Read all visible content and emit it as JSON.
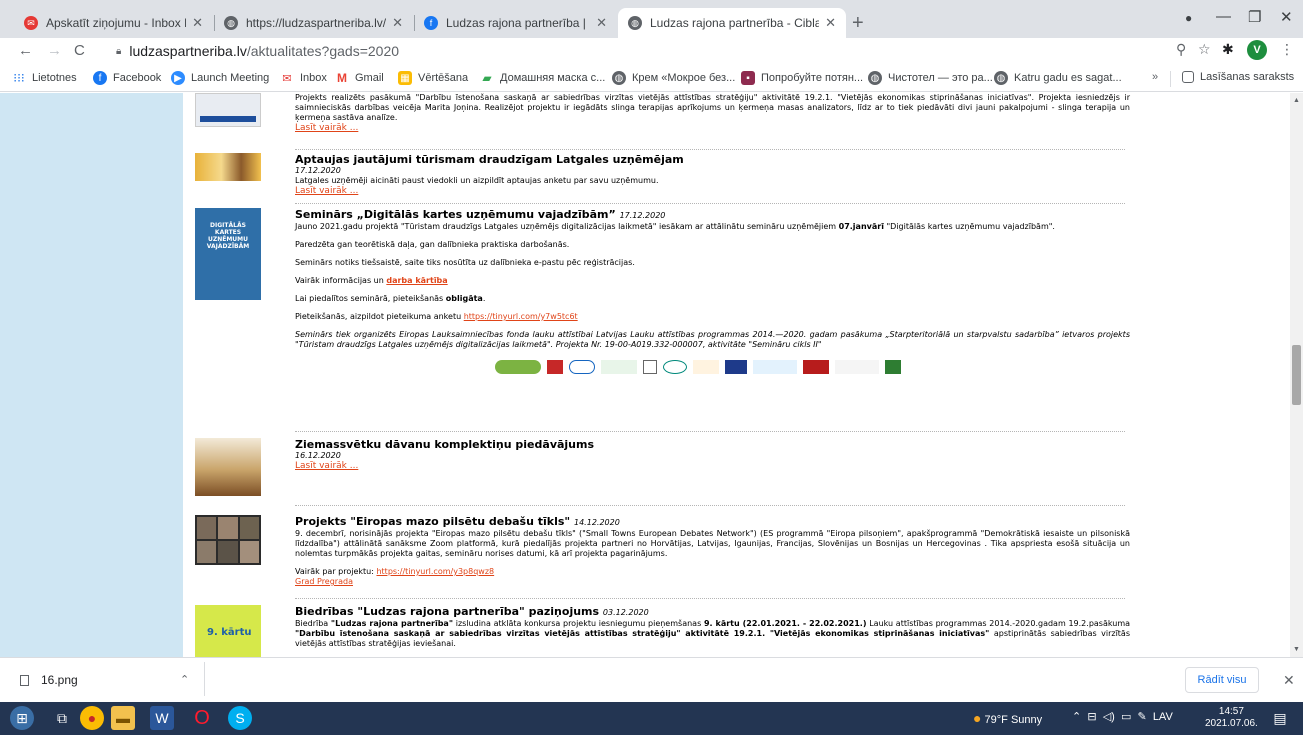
{
  "tabs": [
    {
      "title": "Apskatīt ziņojumu - Inbox Mail"
    },
    {
      "title": "https://ludzaspartneriba.lv/proje"
    },
    {
      "title": "Ludzas rajona partnerība | Facebo"
    },
    {
      "title": "Ludzas rajona partnerība - Ciblas"
    }
  ],
  "address": {
    "domain": "ludzaspartneriba.lv",
    "path": "/aktualitates?gads=2020"
  },
  "profile_initial": "V",
  "bookmarks": [
    {
      "label": "Lietotnes"
    },
    {
      "label": "Facebook"
    },
    {
      "label": "Launch Meeting"
    },
    {
      "label": "Inbox"
    },
    {
      "label": "Gmail"
    },
    {
      "label": "Vērtēšana"
    },
    {
      "label": "Домашняя маска с..."
    },
    {
      "label": "Крем «Мокрое без..."
    },
    {
      "label": "Попробуйте потян..."
    },
    {
      "label": "Чистотел — это ра..."
    },
    {
      "label": "Katru gadu es sagat..."
    }
  ],
  "reading_list": "Lasīšanas saraksts",
  "news": [
    {
      "text": "Projekts realizēts pasākumā \"Darbību īstenošana saskaņā ar sabiedrības virzītas vietējās attīstības stratēģiju\" aktivitātē 19.2.1. \"Vietējās ekonomikas stiprināšanas iniciatīvas\". Projekta iesniedzējs ir saimnieciskās darbības veicēja Marita Joņina. Realizējot projektu ir iegādāts slinga terapijas aprīkojums un ķermeņa masas analizators, līdz ar to tiek piedāvāti divi jauni pakalpojumi - slinga terapija un ķermeņa sastāva analīze.",
      "more": "Lasīt vairāk ..."
    },
    {
      "title": "Aptaujas jautājumi tūrismam draudzīgam Latgales uzņēmējam",
      "date": "17.12.2020",
      "text": "Latgales uzņēmēji aicināti paust viedokli un aizpildīt aptaujas anketu par savu uzņēmumu.",
      "more": "Lasīt vairāk ..."
    },
    {
      "title": "Seminārs „Digitālās kartes uzņēmumu vajadzībām”",
      "date": "17.12.2020",
      "intro_a": "Jauno 2021.gadu projektā \"Tūristam draudzīgs Latgales uzņēmējs digitalizācijas laikmetā\" iesākam ar attālinātu semināru uzņēmējiem",
      "intro_b": "07.janvārī",
      "intro_c": "\"Digitālās kartes uzņēmumu vajadzībām\".",
      "p1": "Paredzēta gan teorētiskā daļa, gan dalībnieka praktiska darbošanās.",
      "p2": "Seminārs notiks tiešsaistē, saite tiks nosūtīta uz dalībnieka e-pastu pēc reģistrācijas.",
      "p3_a": "Vairāk informācijas un",
      "p3_link": "darba kārtība",
      "p4_a": "Lai piedalītos seminārā, pieteikšanās",
      "p4_b": "obligāta",
      "p5_a": "Pieteikšanās, aizpildot pieteikuma anketu",
      "p5_link": "https://tinyurl.com/y7w5tc6t",
      "p6": "Seminārs tiek organizēts Eiropas Lauksaimniecības fonda lauku attīstībai Latvijas Lauku attīstības programmas 2014.—2020. gadam pasākuma „Starpteritoriālā un starpvalstu sadarbība” ietvaros projekts \"Tūristam draudzīgs Latgales uzņēmējs digitalizācijas laikmetā\". Projekta Nr. 19-00-A019.332-000007, aktivitāte \"Semināru cikls II\"",
      "thumb_text": "DIGITĀLĀS KARTES UZŅĒMUMU VAJADZĪBĀM"
    },
    {
      "title": "Ziemassvētku dāvanu komplektiņu piedāvājums",
      "date": "16.12.2020",
      "more": "Lasīt vairāk ..."
    },
    {
      "title": "Projekts \"Eiropas mazo pilsētu debašu tīkls\"",
      "date": "14.12.2020",
      "text": "9. decembrī, norisinājās projekta \"Eiropas mazo pilsētu debašu tīkls\" (\"Small Towns European Debates Network\") (ES programmā \"Eiropa pilsoņiem\", apakšprogrammā \"Demokrātiskā iesaiste un pilsoniskā līdzdalība\") attālinātā sanāksme Zoom platformā, kurā piedalījās projekta partneri no Horvātijas, Latvijas, Igaunijas, Francijas, Slovēnijas un Bosnijas un Hercegovinas . Tika apspriesta esošā situācija un nolemtas turpmākās projekta gaitas, semināru norises datumi, kā arī projekta pagarinājums.",
      "p2_a": "Vairāk par projektu:",
      "p2_link": "https://tinyurl.com/y3p8qwz8",
      "p3_link": "Grad Pregrada"
    },
    {
      "title": "Biedrības \"Ludzas rajona partnerība\" paziņojums",
      "date": "03.12.2020",
      "t1": "Biedrība",
      "t1b": "\"Ludzas rajona partnerība\"",
      "t2": "izsludina atklāta konkursa projektu iesniegumu pieņemšanas",
      "t2b": "9. kārtu (22.01.2021. - 22.02.2021.)",
      "t3": "Lauku attīstības programmas 2014.-2020.gadam 19.2.pasākuma",
      "t3b": "\"Darbību īstenošana saskaņā ar sabiedrības virzītas vietējās attīstības stratēģiju\" aktivitātē 19.2.1. \"Vietējās ekonomikas stiprināšanas iniciatīvas\"",
      "t4": "apstiprinātās sabiedrības virzītās vietējās attīstības stratēģijas ieviešanai.",
      "thumb_text": "9. kārtu"
    }
  ],
  "download": {
    "file": "16.png",
    "show_all": "Rādīt visu"
  },
  "taskbar": {
    "weather": "79°F Sunny",
    "lang": "LAV",
    "time": "14:57",
    "date": "2021.07.06."
  }
}
